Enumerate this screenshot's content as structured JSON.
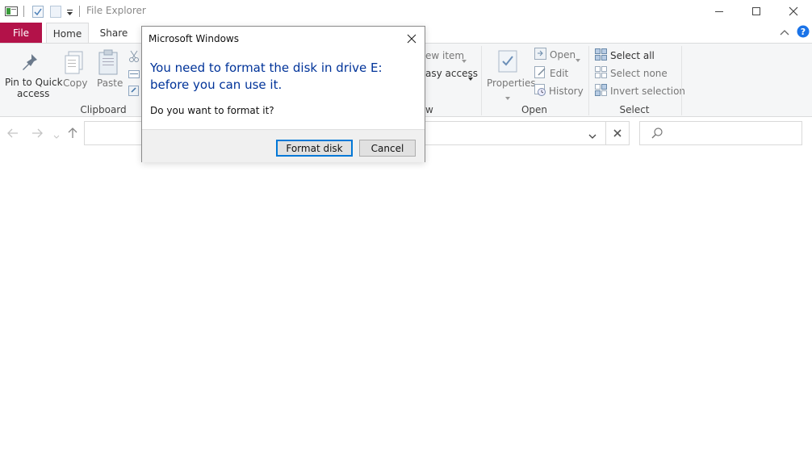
{
  "window": {
    "title": "File Explorer",
    "controls": {
      "minimize": "—",
      "maximize": "☐",
      "close": "✕"
    }
  },
  "ribbon": {
    "tabs": [
      {
        "label": "File"
      },
      {
        "label": "Home"
      },
      {
        "label": "Share"
      }
    ],
    "clipboard": {
      "pin_label": "Pin to Quick access",
      "pin_line1": "Pin to Quick",
      "pin_line2": "access",
      "copy_label": "Copy",
      "paste_label": "Paste",
      "group_label": "Clipboard"
    },
    "new": {
      "new_item_label": "ew item",
      "easy_access_label": "asy access",
      "group_label": "w"
    },
    "open": {
      "properties_label": "Properties",
      "open_label": "Open",
      "edit_label": "Edit",
      "history_label": "History",
      "group_label": "Open"
    },
    "select": {
      "select_all_label": "Select all",
      "select_none_label": "Select none",
      "invert_label": "Invert selection",
      "group_label": "Select"
    }
  },
  "dialog": {
    "title": "Microsoft Windows",
    "message": "You need to format the disk in drive E: before you can use it.",
    "question": "Do you want to format it?",
    "format_button": "Format disk",
    "cancel_button": "Cancel"
  },
  "colors": {
    "file_tab": "#b31249",
    "dialog_message": "#003399",
    "default_button_border": "#0078d7",
    "help_icon": "#1a73e8"
  }
}
